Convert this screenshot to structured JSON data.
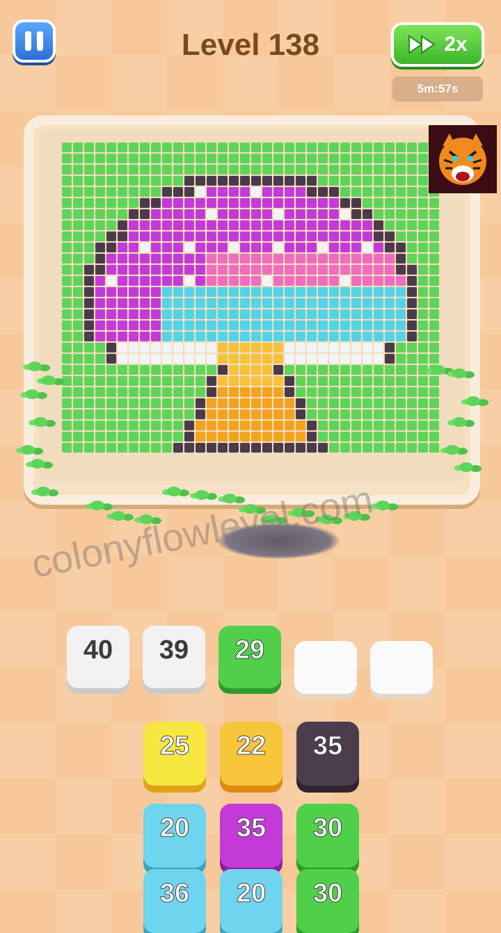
{
  "header": {
    "level_title": "Level 138",
    "speed_label": "2x",
    "timer": "5m:57s"
  },
  "watermark": "colonyflowlevel.com",
  "colors": {
    "green": "#5fd45a",
    "purple": "#c43ad8",
    "pink": "#f06cc0",
    "cyan": "#55d3e6",
    "white": "#f4f4f4",
    "dark": "#4a3a4a",
    "yellow": "#f5df3a",
    "gold": "#f7c23a",
    "orange": "#f3a31f"
  },
  "queue_slots": [
    {
      "value": "40",
      "color": "#f2f2f2",
      "shade": "#c9c9c9",
      "text_dark": true
    },
    {
      "value": "39",
      "color": "#f2f2f2",
      "shade": "#c9c9c9",
      "text_dark": true
    },
    {
      "value": "29",
      "color": "#4fcf4a",
      "shade": "#2f9a2c",
      "text_dark": false
    },
    {
      "value": "",
      "color": "#fafafa",
      "shade": "#e5d6c6",
      "text_dark": true
    },
    {
      "value": "",
      "color": "#fafafa",
      "shade": "#e5d6c6",
      "text_dark": true
    }
  ],
  "stack_rows": [
    [
      {
        "value": "25",
        "color": "#f6e640",
        "shade": "#e0a318"
      },
      {
        "value": "22",
        "color": "#f7c53a",
        "shade": "#e08a12"
      },
      {
        "value": "35",
        "color": "#4b3d4c",
        "shade": "#2d242e"
      }
    ],
    [
      {
        "value": "20",
        "color": "#6fd4ee",
        "shade": "#3aa3c4"
      },
      {
        "value": "35",
        "color": "#c43ad8",
        "shade": "#8a1f9e"
      },
      {
        "value": "30",
        "color": "#4fcf4a",
        "shade": "#2f9a2c"
      }
    ],
    [
      {
        "value": "36",
        "color": "#6fd4ee",
        "shade": "#3aa3c4"
      },
      {
        "value": "20",
        "color": "#6fd4ee",
        "shade": "#3aa3c4"
      },
      {
        "value": "30",
        "color": "#4fcf4a",
        "shade": "#2f9a2c"
      }
    ]
  ]
}
